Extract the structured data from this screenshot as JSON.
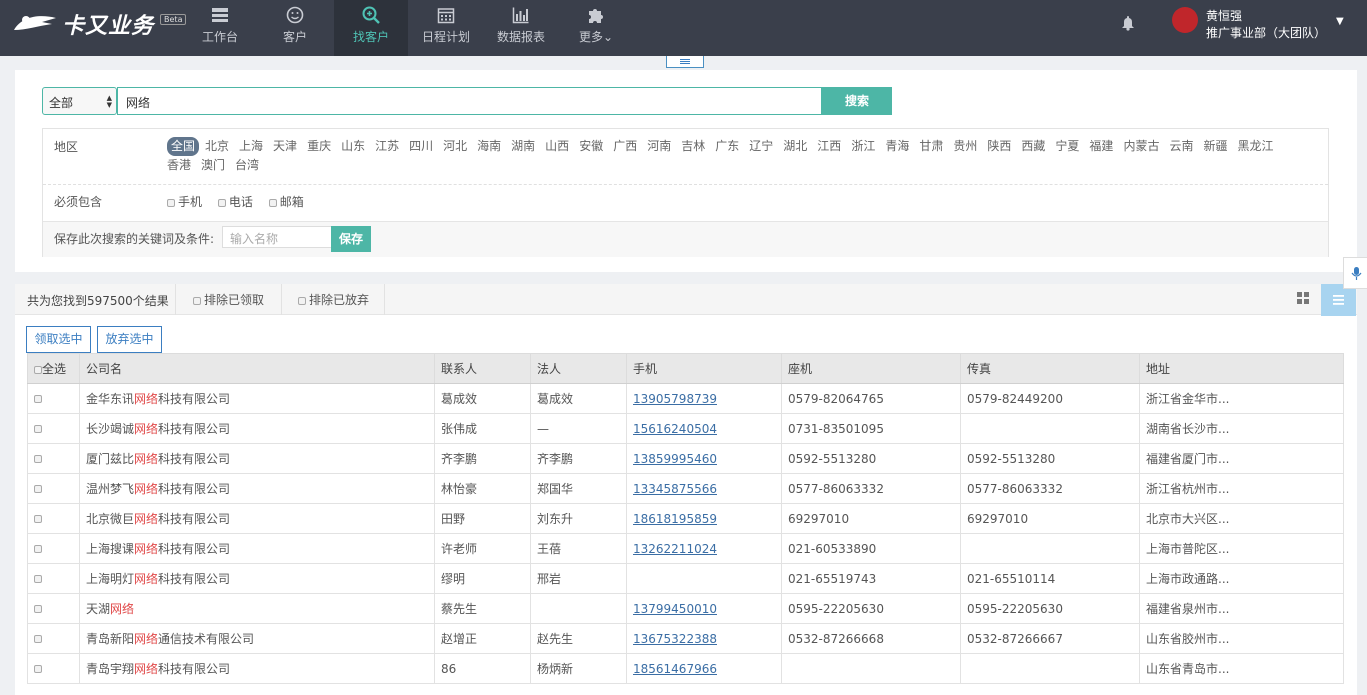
{
  "brand": {
    "logo_text": "卡又业务",
    "beta": "Beta"
  },
  "nav": [
    {
      "label": "工作台",
      "icon": "dashboard-icon"
    },
    {
      "label": "客户",
      "icon": "smiley-icon"
    },
    {
      "label": "找客户",
      "icon": "search-plus-icon",
      "active": true
    },
    {
      "label": "日程计划",
      "icon": "calendar-icon"
    },
    {
      "label": "数据报表",
      "icon": "bar-chart-icon"
    },
    {
      "label": "更多",
      "icon": "puzzle-icon"
    }
  ],
  "user": {
    "name": "黄恒强",
    "dept": "推广事业部（大团队）"
  },
  "search": {
    "scope": "全部",
    "keyword": "网络",
    "button": "搜索"
  },
  "filters": {
    "region_label": "地区",
    "regions": [
      "全国",
      "北京",
      "上海",
      "天津",
      "重庆",
      "山东",
      "江苏",
      "四川",
      "河北",
      "海南",
      "湖南",
      "山西",
      "安徽",
      "广西",
      "河南",
      "吉林",
      "广东",
      "辽宁",
      "湖北",
      "江西",
      "浙江",
      "青海",
      "甘肃",
      "贵州",
      "陕西",
      "西藏",
      "宁夏",
      "福建",
      "内蒙古",
      "云南",
      "新疆",
      "黑龙江",
      "香港",
      "澳门",
      "台湾"
    ],
    "must_label": "必须包含",
    "must_options": [
      "手机",
      "电话",
      "邮箱"
    ],
    "save_label": "保存此次搜索的关键词及条件:",
    "save_placeholder": "输入名称",
    "save_button": "保存"
  },
  "results": {
    "count_text": "共为您找到597500个结果",
    "exclude_claimed": "排除已领取",
    "exclude_abandoned": "排除已放弃",
    "claim_button": "领取选中",
    "abandon_button": "放弃选中",
    "columns": [
      "全选",
      "公司名",
      "联系人",
      "法人",
      "手机",
      "座机",
      "传真",
      "地址"
    ],
    "rows": [
      {
        "pre": "金华东讯",
        "kw": "网络",
        "post": "科技有限公司",
        "contact": "葛成效",
        "legal": "葛成效",
        "mobile": "13905798739",
        "phone": "0579-82064765",
        "fax": "0579-82449200",
        "addr": "浙江省金华市..."
      },
      {
        "pre": "长沙竭诚",
        "kw": "网络",
        "post": "科技有限公司",
        "contact": "张伟成",
        "legal": "—",
        "mobile": "15616240504",
        "phone": "0731-83501095",
        "fax": "",
        "addr": "湖南省长沙市..."
      },
      {
        "pre": "厦门兹比",
        "kw": "网络",
        "post": "科技有限公司",
        "contact": "齐李鹏",
        "legal": "齐李鹏",
        "mobile": "13859995460",
        "phone": "0592-5513280",
        "fax": "0592-5513280",
        "addr": "福建省厦门市..."
      },
      {
        "pre": "温州梦飞",
        "kw": "网络",
        "post": "科技有限公司",
        "contact": "林怡豪",
        "legal": "郑国华",
        "mobile": "13345875566",
        "phone": "0577-86063332",
        "fax": "0577-86063332",
        "addr": "浙江省杭州市..."
      },
      {
        "pre": "北京微巨",
        "kw": "网络",
        "post": "科技有限公司",
        "contact": "田野",
        "legal": "刘东升",
        "mobile": "18618195859",
        "phone": "69297010",
        "fax": "69297010",
        "addr": "北京市大兴区..."
      },
      {
        "pre": "上海搜课",
        "kw": "网络",
        "post": "科技有限公司",
        "contact": "许老师",
        "legal": "王蓓",
        "mobile": "13262211024",
        "phone": "021-60533890",
        "fax": "",
        "addr": "上海市普陀区..."
      },
      {
        "pre": "上海明灯",
        "kw": "网络",
        "post": "科技有限公司",
        "contact": "缪明",
        "legal": "邢岩",
        "mobile": "",
        "phone": "021-65519743",
        "fax": "021-65510114",
        "addr": "上海市政通路..."
      },
      {
        "pre": "天湖",
        "kw": "网络",
        "post": "",
        "contact": "蔡先生",
        "legal": "",
        "mobile": "13799450010",
        "phone": "0595-22205630",
        "fax": "0595-22205630",
        "addr": "福建省泉州市..."
      },
      {
        "pre": "青岛新阳",
        "kw": "网络",
        "post": "通信技术有限公司",
        "contact": "赵增正",
        "legal": "赵先生",
        "mobile": "13675322388",
        "phone": "0532-87266668",
        "fax": "0532-87266667",
        "addr": "山东省胶州市..."
      },
      {
        "pre": "青岛宇翔",
        "kw": "网络",
        "post": "科技有限公司",
        "contact": "86",
        "legal": "杨炳新",
        "mobile": "18561467966",
        "phone": "",
        "fax": "",
        "addr": "山东省青岛市..."
      }
    ]
  },
  "colors": {
    "accent": "#4db6a6",
    "nav_bg": "#3a3f4b",
    "link": "#3b7ec1",
    "keyword": "#e04848"
  }
}
